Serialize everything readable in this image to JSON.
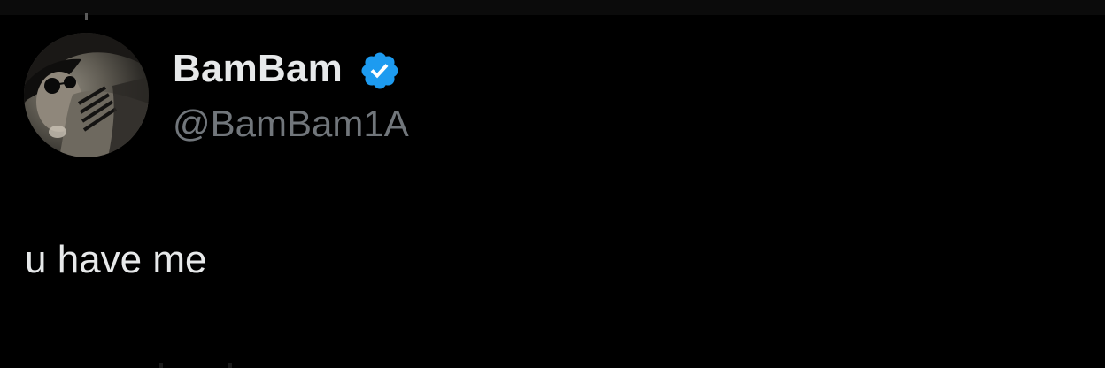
{
  "tweet": {
    "author": {
      "display_name": "BamBam",
      "handle": "@BamBam1A",
      "verified": true,
      "verified_icon": "verified-badge-icon",
      "avatar_icon": "profile-photo"
    },
    "text": "u have me"
  },
  "colors": {
    "background": "#000000",
    "primary_text": "#e7e9ea",
    "secondary_text": "#71767b",
    "verified_blue": "#1d9bf0"
  }
}
